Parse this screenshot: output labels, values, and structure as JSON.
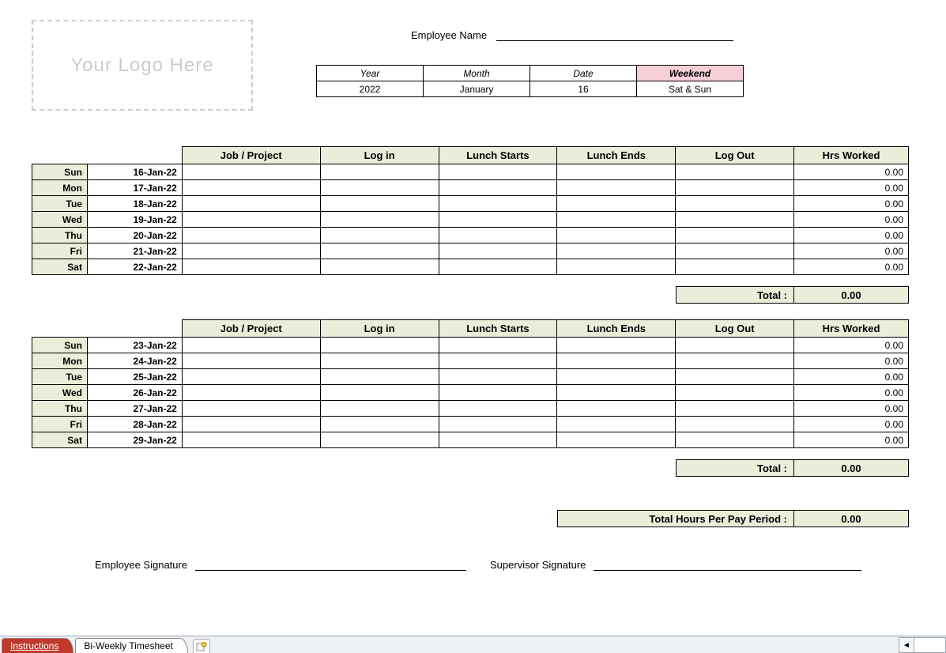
{
  "logo_placeholder": "Your Logo Here",
  "employee_name_label": "Employee Name",
  "info": {
    "headers": {
      "year": "Year",
      "month": "Month",
      "date": "Date",
      "weekend": "Weekend"
    },
    "values": {
      "year": "2022",
      "month": "January",
      "date": "16",
      "weekend": "Sat & Sun"
    }
  },
  "columns": {
    "job": "Job / Project",
    "login": "Log in",
    "lunch_starts": "Lunch Starts",
    "lunch_ends": "Lunch Ends",
    "logout": "Log Out",
    "hrs_worked": "Hrs Worked"
  },
  "week1": {
    "rows": [
      {
        "day": "Sun",
        "date": "16-Jan-22",
        "hw": "0.00"
      },
      {
        "day": "Mon",
        "date": "17-Jan-22",
        "hw": "0.00"
      },
      {
        "day": "Tue",
        "date": "18-Jan-22",
        "hw": "0.00"
      },
      {
        "day": "Wed",
        "date": "19-Jan-22",
        "hw": "0.00"
      },
      {
        "day": "Thu",
        "date": "20-Jan-22",
        "hw": "0.00"
      },
      {
        "day": "Fri",
        "date": "21-Jan-22",
        "hw": "0.00"
      },
      {
        "day": "Sat",
        "date": "22-Jan-22",
        "hw": "0.00"
      }
    ],
    "total_label": "Total :",
    "total_value": "0.00"
  },
  "week2": {
    "rows": [
      {
        "day": "Sun",
        "date": "23-Jan-22",
        "hw": "0.00"
      },
      {
        "day": "Mon",
        "date": "24-Jan-22",
        "hw": "0.00"
      },
      {
        "day": "Tue",
        "date": "25-Jan-22",
        "hw": "0.00"
      },
      {
        "day": "Wed",
        "date": "26-Jan-22",
        "hw": "0.00"
      },
      {
        "day": "Thu",
        "date": "27-Jan-22",
        "hw": "0.00"
      },
      {
        "day": "Fri",
        "date": "28-Jan-22",
        "hw": "0.00"
      },
      {
        "day": "Sat",
        "date": "29-Jan-22",
        "hw": "0.00"
      }
    ],
    "total_label": "Total :",
    "total_value": "0.00"
  },
  "pay_period": {
    "label": "Total Hours Per Pay Period :",
    "value": "0.00"
  },
  "signatures": {
    "employee": "Employee Signature",
    "supervisor": "Supervisor Signature"
  },
  "tabs": {
    "instructions": "Instructions",
    "timesheet": "Bi-Weekly Timesheet"
  }
}
